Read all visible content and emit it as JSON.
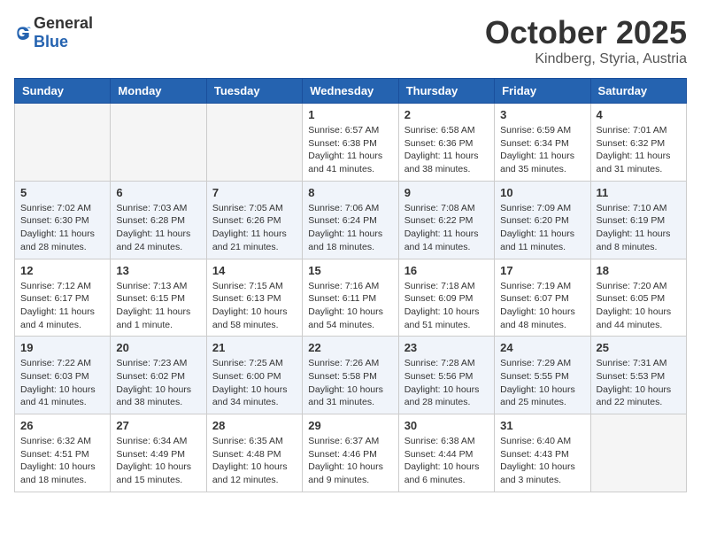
{
  "header": {
    "logo_general": "General",
    "logo_blue": "Blue",
    "month_title": "October 2025",
    "subtitle": "Kindberg, Styria, Austria"
  },
  "weekdays": [
    "Sunday",
    "Monday",
    "Tuesday",
    "Wednesday",
    "Thursday",
    "Friday",
    "Saturday"
  ],
  "weeks": [
    [
      {
        "day": "",
        "info": ""
      },
      {
        "day": "",
        "info": ""
      },
      {
        "day": "",
        "info": ""
      },
      {
        "day": "1",
        "info": "Sunrise: 6:57 AM\nSunset: 6:38 PM\nDaylight: 11 hours\nand 41 minutes."
      },
      {
        "day": "2",
        "info": "Sunrise: 6:58 AM\nSunset: 6:36 PM\nDaylight: 11 hours\nand 38 minutes."
      },
      {
        "day": "3",
        "info": "Sunrise: 6:59 AM\nSunset: 6:34 PM\nDaylight: 11 hours\nand 35 minutes."
      },
      {
        "day": "4",
        "info": "Sunrise: 7:01 AM\nSunset: 6:32 PM\nDaylight: 11 hours\nand 31 minutes."
      }
    ],
    [
      {
        "day": "5",
        "info": "Sunrise: 7:02 AM\nSunset: 6:30 PM\nDaylight: 11 hours\nand 28 minutes."
      },
      {
        "day": "6",
        "info": "Sunrise: 7:03 AM\nSunset: 6:28 PM\nDaylight: 11 hours\nand 24 minutes."
      },
      {
        "day": "7",
        "info": "Sunrise: 7:05 AM\nSunset: 6:26 PM\nDaylight: 11 hours\nand 21 minutes."
      },
      {
        "day": "8",
        "info": "Sunrise: 7:06 AM\nSunset: 6:24 PM\nDaylight: 11 hours\nand 18 minutes."
      },
      {
        "day": "9",
        "info": "Sunrise: 7:08 AM\nSunset: 6:22 PM\nDaylight: 11 hours\nand 14 minutes."
      },
      {
        "day": "10",
        "info": "Sunrise: 7:09 AM\nSunset: 6:20 PM\nDaylight: 11 hours\nand 11 minutes."
      },
      {
        "day": "11",
        "info": "Sunrise: 7:10 AM\nSunset: 6:19 PM\nDaylight: 11 hours\nand 8 minutes."
      }
    ],
    [
      {
        "day": "12",
        "info": "Sunrise: 7:12 AM\nSunset: 6:17 PM\nDaylight: 11 hours\nand 4 minutes."
      },
      {
        "day": "13",
        "info": "Sunrise: 7:13 AM\nSunset: 6:15 PM\nDaylight: 11 hours\nand 1 minute."
      },
      {
        "day": "14",
        "info": "Sunrise: 7:15 AM\nSunset: 6:13 PM\nDaylight: 10 hours\nand 58 minutes."
      },
      {
        "day": "15",
        "info": "Sunrise: 7:16 AM\nSunset: 6:11 PM\nDaylight: 10 hours\nand 54 minutes."
      },
      {
        "day": "16",
        "info": "Sunrise: 7:18 AM\nSunset: 6:09 PM\nDaylight: 10 hours\nand 51 minutes."
      },
      {
        "day": "17",
        "info": "Sunrise: 7:19 AM\nSunset: 6:07 PM\nDaylight: 10 hours\nand 48 minutes."
      },
      {
        "day": "18",
        "info": "Sunrise: 7:20 AM\nSunset: 6:05 PM\nDaylight: 10 hours\nand 44 minutes."
      }
    ],
    [
      {
        "day": "19",
        "info": "Sunrise: 7:22 AM\nSunset: 6:03 PM\nDaylight: 10 hours\nand 41 minutes."
      },
      {
        "day": "20",
        "info": "Sunrise: 7:23 AM\nSunset: 6:02 PM\nDaylight: 10 hours\nand 38 minutes."
      },
      {
        "day": "21",
        "info": "Sunrise: 7:25 AM\nSunset: 6:00 PM\nDaylight: 10 hours\nand 34 minutes."
      },
      {
        "day": "22",
        "info": "Sunrise: 7:26 AM\nSunset: 5:58 PM\nDaylight: 10 hours\nand 31 minutes."
      },
      {
        "day": "23",
        "info": "Sunrise: 7:28 AM\nSunset: 5:56 PM\nDaylight: 10 hours\nand 28 minutes."
      },
      {
        "day": "24",
        "info": "Sunrise: 7:29 AM\nSunset: 5:55 PM\nDaylight: 10 hours\nand 25 minutes."
      },
      {
        "day": "25",
        "info": "Sunrise: 7:31 AM\nSunset: 5:53 PM\nDaylight: 10 hours\nand 22 minutes."
      }
    ],
    [
      {
        "day": "26",
        "info": "Sunrise: 6:32 AM\nSunset: 4:51 PM\nDaylight: 10 hours\nand 18 minutes."
      },
      {
        "day": "27",
        "info": "Sunrise: 6:34 AM\nSunset: 4:49 PM\nDaylight: 10 hours\nand 15 minutes."
      },
      {
        "day": "28",
        "info": "Sunrise: 6:35 AM\nSunset: 4:48 PM\nDaylight: 10 hours\nand 12 minutes."
      },
      {
        "day": "29",
        "info": "Sunrise: 6:37 AM\nSunset: 4:46 PM\nDaylight: 10 hours\nand 9 minutes."
      },
      {
        "day": "30",
        "info": "Sunrise: 6:38 AM\nSunset: 4:44 PM\nDaylight: 10 hours\nand 6 minutes."
      },
      {
        "day": "31",
        "info": "Sunrise: 6:40 AM\nSunset: 4:43 PM\nDaylight: 10 hours\nand 3 minutes."
      },
      {
        "day": "",
        "info": ""
      }
    ]
  ]
}
